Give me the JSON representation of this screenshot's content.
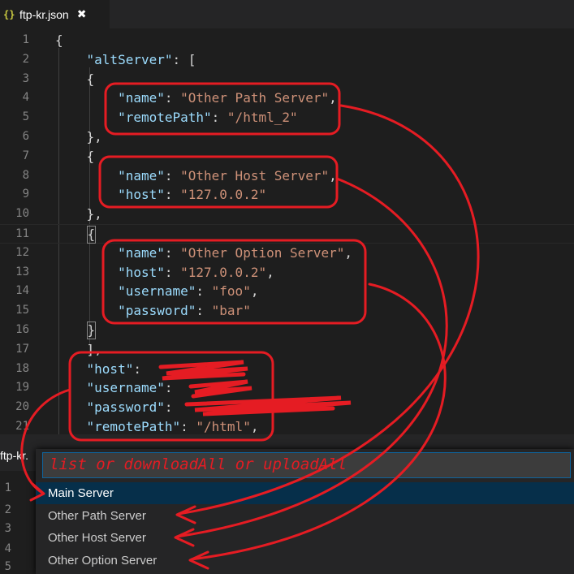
{
  "tab": {
    "icon": "json-braces-icon",
    "braces": "{}",
    "label": "ftp-kr.json",
    "close_glyph": "✖"
  },
  "editor": {
    "line_numbers": [
      "1",
      "2",
      "3",
      "4",
      "5",
      "6",
      "7",
      "8",
      "9",
      "10",
      "11",
      "12",
      "13",
      "14",
      "15",
      "16",
      "17",
      "18",
      "19",
      "20",
      "21"
    ],
    "code": {
      "l1_open": "{",
      "l2_key": "\"altServer\"",
      "l2_rest": ": [",
      "l3": "{",
      "l4_key": "\"name\"",
      "l4_val": "\"Other Path Server\"",
      "l5_key": "\"remotePath\"",
      "l5_val": "\"/html_2\"",
      "l6": "},",
      "l7": "{",
      "l8_key": "\"name\"",
      "l8_val": "\"Other Host Server\"",
      "l9_key": "\"host\"",
      "l9_val": "\"127.0.0.2\"",
      "l10": "},",
      "l11": "{",
      "l12_key": "\"name\"",
      "l12_val": "\"Other Option Server\"",
      "l13_key": "\"host\"",
      "l13_val": "\"127.0.0.2\"",
      "l14_key": "\"username\"",
      "l14_val": "\"foo\"",
      "l15_key": "\"password\"",
      "l15_val": "\"bar\"",
      "l16": "}",
      "l17": "],",
      "l18_key": "\"host\"",
      "l19_key": "\"username\"",
      "l20_key": "\"password\"",
      "l21_key": "\"remotePath\"",
      "l21_val": "\"/html\""
    }
  },
  "lower_window": {
    "tab_label": "ftp-kr.",
    "line_numbers": [
      "1",
      "2",
      "3",
      "4",
      "5"
    ]
  },
  "quick_pick": {
    "placeholder": "list or downloadAll or uploadAll",
    "items": [
      "Main Server",
      "Other Path Server",
      "Other Host Server",
      "Other Option Server"
    ],
    "selected_index": 0
  },
  "colors": {
    "annotation": "#e51c23",
    "selection": "#062f4a",
    "key": "#9cdcfe",
    "string": "#ce9178"
  }
}
